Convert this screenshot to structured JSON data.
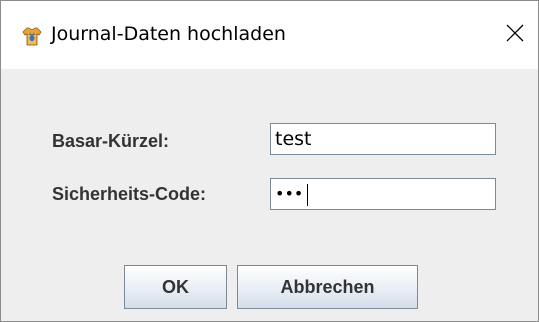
{
  "window": {
    "title": "Journal-Daten hochladen",
    "app_icon": "shirt-upload-icon",
    "close_icon": "close-icon"
  },
  "form": {
    "basar_label": "Basar-Kürzel:",
    "basar_value": "test",
    "code_label": "Sicherheits-Code:",
    "code_value_masked": "•••"
  },
  "buttons": {
    "ok_label": "OK",
    "cancel_label": "Abbrechen"
  },
  "colors": {
    "dialog_background": "#eeeeee",
    "titlebar_background": "#ffffff",
    "label_text": "#333333",
    "field_border": "#7a8a99",
    "button_gradient_top": "#ffffff",
    "button_gradient_bottom": "#d4dde8"
  }
}
